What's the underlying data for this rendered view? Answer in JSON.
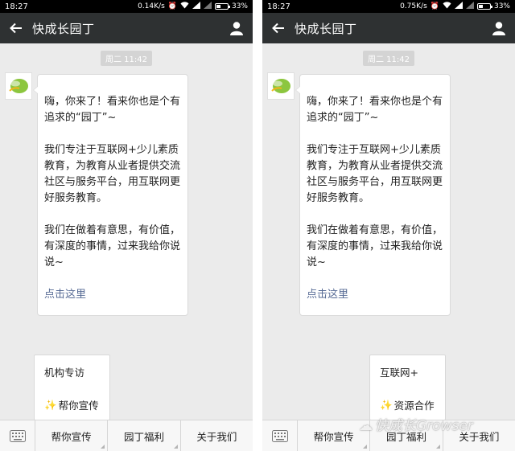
{
  "colors": {
    "titlebar_bg": "#2e3132",
    "chat_bg": "#ebebeb",
    "link": "#576b95",
    "sparkle": "#f3b51a",
    "avatar_green": "#8cc63f"
  },
  "screens": [
    {
      "status": {
        "time": "18:27",
        "net_speed": "0.14K/s",
        "battery": "33%",
        "battery_level": 0.33
      },
      "header": {
        "title": "快成长园丁",
        "back_icon": "arrow-left-icon",
        "profile_icon": "person-icon"
      },
      "timestamp": "周二 11:42",
      "message": {
        "para1": "嗨，你来了！看来你也是个有追求的“园丁”~",
        "para2": "我们专注于互联网+少儿素质教育，为教育从业者提供交流社区与服务平台，用互联网更好服务教育。",
        "para3": "我们在做着有意思，有价值，有深度的事情，过来我给你说说~",
        "link": "点击这里"
      },
      "submenu": {
        "items": [
          "机构专访",
          "帮你宣传"
        ]
      },
      "menu": {
        "items": [
          "帮你宣传",
          "园丁福利",
          "关于我们"
        ]
      }
    },
    {
      "status": {
        "time": "18:27",
        "net_speed": "0.75K/s",
        "battery": "33%",
        "battery_level": 0.33
      },
      "header": {
        "title": "快成长园丁",
        "back_icon": "arrow-left-icon",
        "profile_icon": "person-icon"
      },
      "timestamp": "周二 11:42",
      "message": {
        "para1": "嗨，你来了！看来你也是个有追求的“园丁”~",
        "para2": "我们专注于互联网+少儿素质教育，为教育从业者提供交流社区与服务平台，用互联网更好服务教育。",
        "para3": "我们在做着有意思，有价值，有深度的事情，过来我给你说说~",
        "link": "点击这里"
      },
      "submenu": {
        "items": [
          "互联网+",
          "资源合作"
        ]
      },
      "menu": {
        "items": [
          "帮你宣传",
          "园丁福利",
          "关于我们"
        ]
      }
    }
  ],
  "watermark": "快成长Growser"
}
